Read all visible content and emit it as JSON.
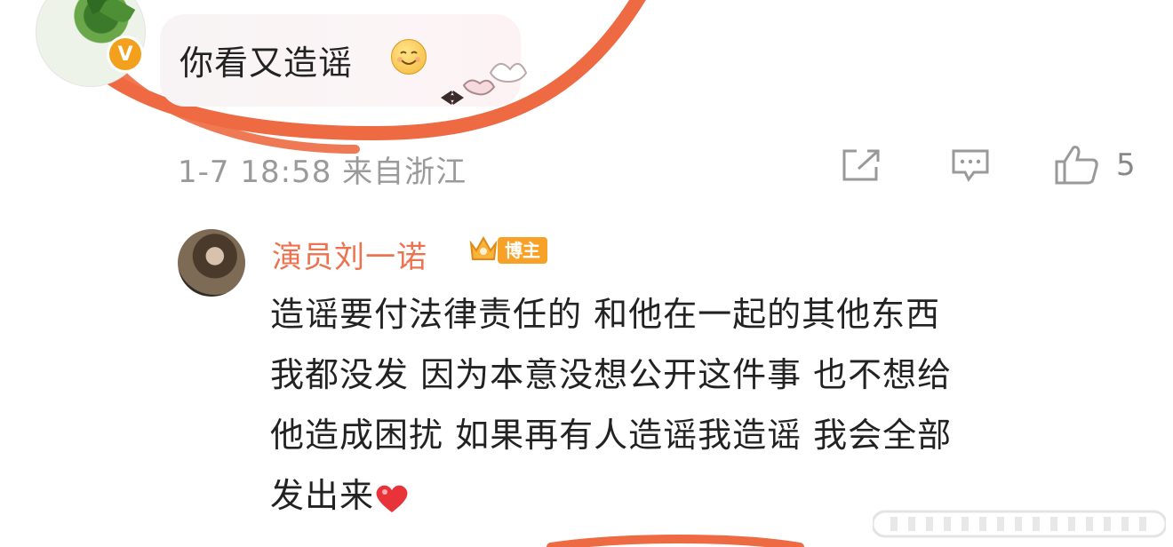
{
  "comment": {
    "text": "你看又造谣",
    "emoji": "smile-emoji",
    "meta": "1-7 18:58 来自浙江",
    "like_count": "5"
  },
  "reply": {
    "author": "演员刘一诺",
    "badge": "博主",
    "lines": [
      "造谣要付法律责任的 和他在一起的其他东西",
      "我都没发 因为本意没想公开这件事 也不想给",
      "他造成困扰 如果再有人造谣我造谣 我会全部",
      "发出来"
    ]
  },
  "icons": [
    "verified-badge-icon",
    "share-icon",
    "comment-icon",
    "like-icon",
    "crown-icon",
    "heart-icon"
  ],
  "colors": {
    "accent": "#eb7350",
    "ring": "#ee6a43",
    "badge": "#f7a128",
    "meta": "#9a9a9a"
  }
}
